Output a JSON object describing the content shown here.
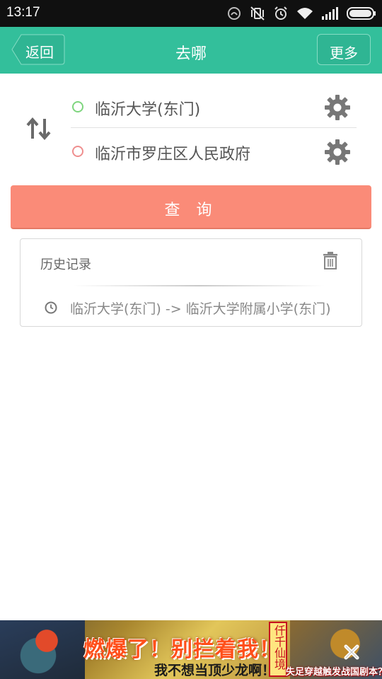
{
  "status_bar": {
    "time": "13:17",
    "icons": [
      "alarm-circle-icon",
      "vibrate-mute-icon",
      "alarm-clock-icon",
      "wifi-icon",
      "signal-icon",
      "battery-icon"
    ]
  },
  "header": {
    "back_label": "返回",
    "title": "去哪",
    "more_label": "更多",
    "color": "#33bf9b"
  },
  "route": {
    "from": "临沂大学(东门)",
    "to": "临沂市罗庄区人民政府",
    "from_dot_color": "#7ed57e",
    "to_dot_color": "#ef8e8e"
  },
  "query_button": {
    "label": "查 询",
    "color": "#fa8b78"
  },
  "history": {
    "title": "历史记录",
    "items": [
      {
        "text": "临沂大学(东门) -> 临沂大学附属小学(东门)"
      }
    ]
  },
  "ad": {
    "headline": "燃爆了！别拦着我！",
    "subline": "我不想当顶少龙啊！",
    "tag": "仟千仙境",
    "right_text": "失足穿越触发战国剧本？"
  }
}
